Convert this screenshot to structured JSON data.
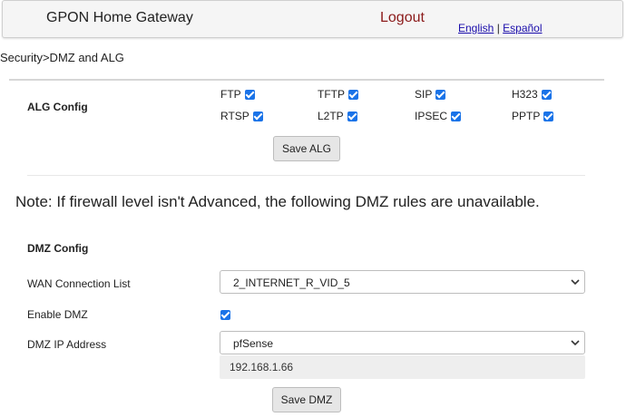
{
  "header": {
    "title": "GPON Home Gateway",
    "logout": "Logout",
    "lang_english": "English",
    "lang_separator": " | ",
    "lang_spanish": "Español"
  },
  "breadcrumb": "Security>DMZ and ALG",
  "alg": {
    "label": "ALG Config",
    "items": [
      {
        "label": "FTP",
        "checked": true
      },
      {
        "label": "TFTP",
        "checked": true
      },
      {
        "label": "SIP",
        "checked": true
      },
      {
        "label": "H323",
        "checked": true
      },
      {
        "label": "RTSP",
        "checked": true
      },
      {
        "label": "L2TP",
        "checked": true
      },
      {
        "label": "IPSEC",
        "checked": true
      },
      {
        "label": "PPTP",
        "checked": true
      }
    ],
    "save_label": "Save ALG"
  },
  "note": "Note: If firewall level isn't Advanced, the following DMZ rules are unavailable.",
  "dmz": {
    "title": "DMZ Config",
    "wan_label": "WAN Connection List",
    "wan_value": "2_INTERNET_R_VID_5",
    "enable_label": "Enable DMZ",
    "enable_checked": true,
    "ip_label": "DMZ IP Address",
    "ip_select_value": "pfSense",
    "ip_value": "192.168.1.66",
    "save_label": "Save DMZ"
  },
  "colors": {
    "accent": "#1a73e8",
    "logout": "#8b1a1a",
    "link": "#1a0dab"
  }
}
